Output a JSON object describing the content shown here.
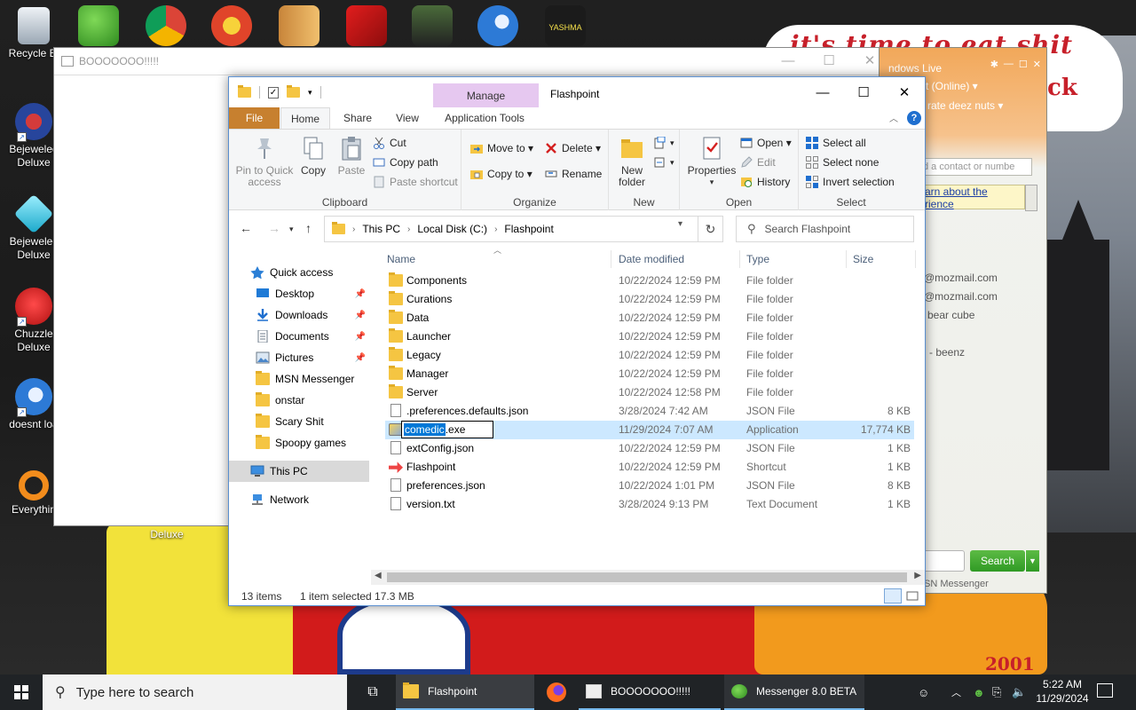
{
  "desktop": {
    "left_icons": [
      {
        "label": "Recycle Bin",
        "color": "#c9d3de"
      },
      {
        "label": "Bejeweled Deluxe",
        "color": "#2a4fa8"
      },
      {
        "label": "Bejeweled Deluxe",
        "color": "#20c4d8"
      },
      {
        "label": "Chuzzle Deluxe",
        "color": "#d42a2a"
      },
      {
        "label": "doesnt load",
        "color": "#2f7fd8"
      },
      {
        "label": "Everything",
        "color": "#f28c1c"
      }
    ],
    "top_icons": [
      "msn-buddies-icon",
      "chrome-icon",
      "pinball-icon",
      "folder-book-icon",
      "flash-icon",
      "shield-game-icon",
      "thunderbird-icon",
      "yashma-icon"
    ],
    "recycle_bin_label": "Recycle Bi",
    "icon_labels": {
      "bejeweled1_line1": "Bejeweled",
      "bejeweled1_line2": "Deluxe",
      "bejeweled2_line1": "Bejewelec",
      "bejeweled2_line2": "Deluxe",
      "chuzzle_line1": "Chuzzle",
      "chuzzle_line2": "Deluxe",
      "doesnt_load": "doesnt loa",
      "everything": "Everythin",
      "deluxe_under": "Deluxe",
      "yashma": "YASHMA"
    },
    "wallpaper_text": {
      "cloud_line1": "it's time to eat shit",
      "cloud_line2": "ck",
      "year": "2001"
    }
  },
  "booo_window": {
    "title": "BOOOOOOO!!!!!",
    "minimize": "—",
    "maximize": "☐",
    "close": "✕"
  },
  "messenger": {
    "title": "ndows Live",
    "status": "t  (Online) ▾",
    "nickname": "rate deez nuts ▾",
    "add_contact_placeholder": "d a contact or numbe",
    "learn_line1": "arn about the",
    "learn_line2": "rience",
    "contacts": [
      "@mozmail.com",
      "@mozmail.com",
      "bear cube",
      "- beenz"
    ],
    "search_label": "Search",
    "footer": "SN Messenger"
  },
  "explorer": {
    "title": "Flashpoint",
    "contextual_tab": "Manage",
    "ribbon_tabs": {
      "file": "File",
      "home": "Home",
      "share": "Share",
      "view": "View",
      "app_tools": "Application Tools"
    },
    "clipboard": {
      "pin": "Pin to Quick access",
      "pin_line1": "Pin to Quick",
      "pin_line2": "access",
      "copy": "Copy",
      "paste": "Paste",
      "cut": "Cut",
      "copy_path": "Copy path",
      "paste_shortcut": "Paste shortcut",
      "group": "Clipboard"
    },
    "organize": {
      "move_to": "Move to ▾",
      "copy_to": "Copy to ▾",
      "delete": "Delete ▾",
      "rename": "Rename",
      "group": "Organize"
    },
    "new_group": {
      "new_folder_line1": "New",
      "new_folder_line2": "folder",
      "group": "New"
    },
    "open_group": {
      "properties": "Properties",
      "open": "Open ▾",
      "edit": "Edit",
      "history": "History",
      "group": "Open"
    },
    "select_group": {
      "select_all": "Select all",
      "select_none": "Select none",
      "invert": "Invert selection",
      "group": "Select"
    },
    "address": {
      "crumbs": [
        "This PC",
        "Local Disk (C:)",
        "Flashpoint"
      ],
      "search_placeholder": "Search Flashpoint"
    },
    "nav_pane": [
      {
        "label": "Quick access",
        "icon": "star-icon"
      },
      {
        "label": "Desktop",
        "icon": "desktop-icon",
        "pinned": true
      },
      {
        "label": "Downloads",
        "icon": "download-icon",
        "pinned": true
      },
      {
        "label": "Documents",
        "icon": "documents-icon",
        "pinned": true
      },
      {
        "label": "Pictures",
        "icon": "pictures-icon",
        "pinned": true
      },
      {
        "label": "MSN Messenger",
        "icon": "folder-icon"
      },
      {
        "label": "onstar",
        "icon": "folder-icon"
      },
      {
        "label": "Scary Shit",
        "icon": "folder-icon"
      },
      {
        "label": "Spoopy games",
        "icon": "folder-icon"
      },
      {
        "label": "This PC",
        "icon": "pc-icon"
      },
      {
        "label": "Network",
        "icon": "network-icon"
      }
    ],
    "columns": {
      "name": "Name",
      "date": "Date modified",
      "type": "Type",
      "size": "Size"
    },
    "files": [
      {
        "name": "Components",
        "date": "10/22/2024 12:59 PM",
        "type": "File folder",
        "size": "",
        "kind": "folder"
      },
      {
        "name": "Curations",
        "date": "10/22/2024 12:59 PM",
        "type": "File folder",
        "size": "",
        "kind": "folder"
      },
      {
        "name": "Data",
        "date": "10/22/2024 12:59 PM",
        "type": "File folder",
        "size": "",
        "kind": "folder"
      },
      {
        "name": "Launcher",
        "date": "10/22/2024 12:59 PM",
        "type": "File folder",
        "size": "",
        "kind": "folder"
      },
      {
        "name": "Legacy",
        "date": "10/22/2024 12:59 PM",
        "type": "File folder",
        "size": "",
        "kind": "folder"
      },
      {
        "name": "Manager",
        "date": "10/22/2024 12:59 PM",
        "type": "File folder",
        "size": "",
        "kind": "folder"
      },
      {
        "name": "Server",
        "date": "10/22/2024 12:58 PM",
        "type": "File folder",
        "size": "",
        "kind": "folder"
      },
      {
        "name": ".preferences.defaults.json",
        "date": "3/28/2024 7:42 AM",
        "type": "JSON File",
        "size": "8 KB",
        "kind": "doc"
      },
      {
        "name": "comedic.exe",
        "date": "11/29/2024 7:07 AM",
        "type": "Application",
        "size": "17,774 KB",
        "kind": "app"
      },
      {
        "name": "extConfig.json",
        "date": "10/22/2024 12:59 PM",
        "type": "JSON File",
        "size": "1 KB",
        "kind": "doc"
      },
      {
        "name": "Flashpoint",
        "date": "10/22/2024 12:59 PM",
        "type": "Shortcut",
        "size": "1 KB",
        "kind": "shortcut"
      },
      {
        "name": "preferences.json",
        "date": "10/22/2024 1:01 PM",
        "type": "JSON File",
        "size": "8 KB",
        "kind": "doc"
      },
      {
        "name": "version.txt",
        "date": "3/28/2024 9:13 PM",
        "type": "Text Document",
        "size": "1 KB",
        "kind": "doc"
      }
    ],
    "rename": {
      "selected": "comedic",
      "rest": ".exe"
    },
    "status": {
      "count": "13 items",
      "selected": "1 item selected  17.3 MB"
    }
  },
  "taskbar": {
    "search_placeholder": "Type here to search",
    "apps": {
      "flashpoint": "Flashpoint",
      "booo": "BOOOOOOO!!!!!",
      "messenger": "Messenger 8.0 BETA"
    },
    "time": "5:22 AM",
    "date": "11/29/2024"
  }
}
